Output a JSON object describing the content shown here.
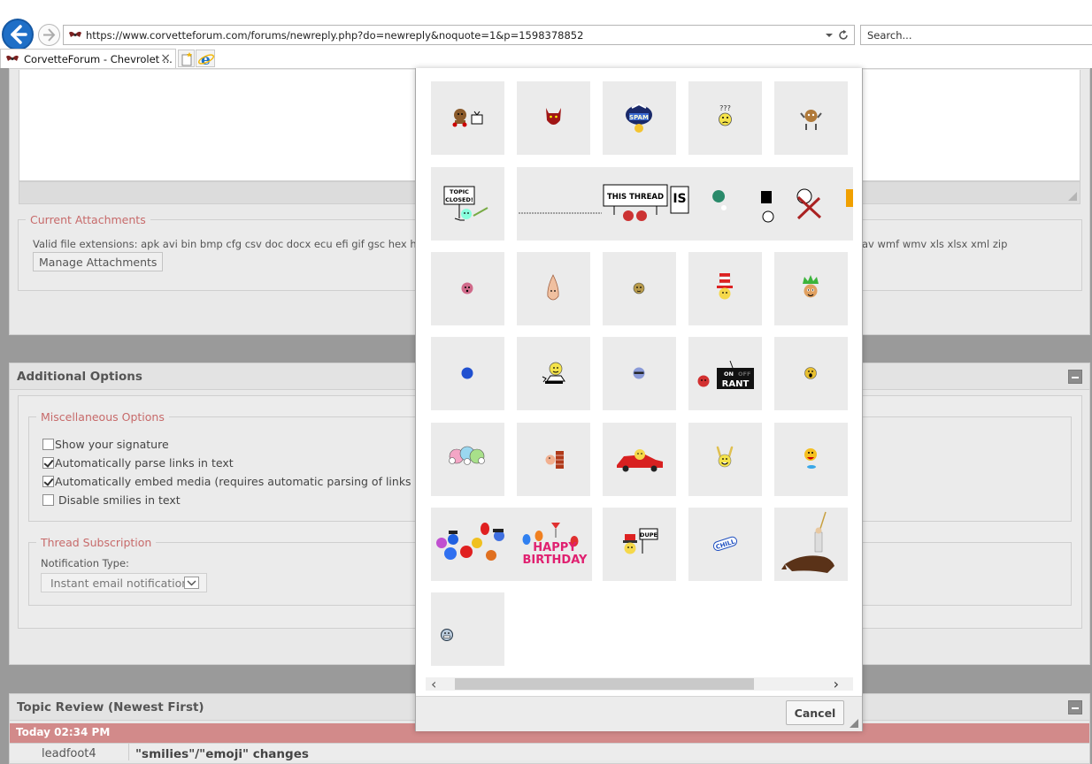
{
  "browser": {
    "url": "https://www.corvetteforum.com/forums/newreply.php?do=newreply&noquote=1&p=1598378852",
    "search_placeholder": "Search...",
    "tab_title": "CorvetteForum - Chevrolet ...",
    "tab_close": "×"
  },
  "attachments": {
    "legend": "Current Attachments",
    "valid_extensions": "Valid file extensions: apk avi bin bmp cfg csv doc docx ecu efi gif gsc hex hpl h",
    "valid_extensions_tail": "av wmf wmv xls xlsx xml zip",
    "manage_button": "Manage Attachments"
  },
  "additional_options": {
    "title": "Additional Options",
    "misc_legend": "Miscellaneous Options",
    "options": [
      {
        "label": "Show your signature",
        "checked": false
      },
      {
        "label": "Automatically parse links in text",
        "checked": true
      },
      {
        "label": "Automatically embed media (requires automatic parsing of links in tex",
        "checked": true
      },
      {
        "label": " Disable smilies in text",
        "checked": false
      }
    ],
    "thread_sub_legend": "Thread Subscription",
    "notification_label": "Notification Type:",
    "notification_value": "Instant email notification"
  },
  "topic_review": {
    "title": "Topic Review (Newest First)",
    "date": "Today 02:34 PM",
    "user": "leadfoot4",
    "post_title": "\"smilies\"/\"emoji\" changes"
  },
  "smilies_dialog": {
    "cancel_button": "Cancel",
    "tile_texts": {
      "spam": "SPAM",
      "question": "???",
      "topic_closed_1": "TOPIC",
      "topic_closed_2": "CLOSED!",
      "this_thread": "THIS THREAD",
      "is": "IS",
      "rant_on": "ON",
      "rant_off": "OFF",
      "rant": "RANT",
      "happy": "HAPPY",
      "birthday": "BIRTHDAY",
      "dupe": "DUPE",
      "chill": "CHILL"
    }
  }
}
